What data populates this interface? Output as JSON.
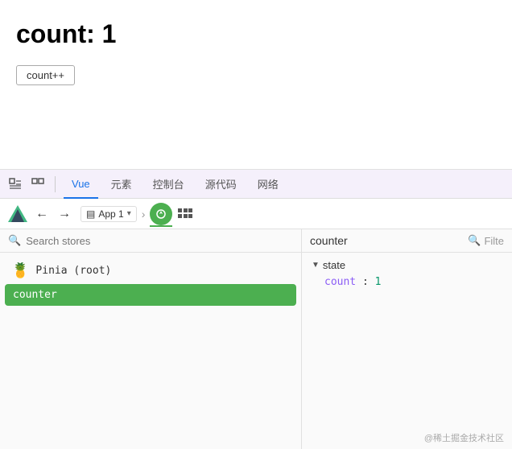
{
  "app": {
    "count_label": "count: 1",
    "button_label": "count++"
  },
  "devtools": {
    "toolbar": {
      "tabs": [
        "Vue",
        "元素",
        "控制台",
        "源代码",
        "网络"
      ],
      "active_tab": "Vue"
    },
    "vue_bar": {
      "app_name": "App 1",
      "breadcrumb_arrow": "›"
    },
    "left": {
      "search_placeholder": "Search stores",
      "stores": [
        {
          "emoji": "🍍",
          "name": "Pinia (root)"
        },
        {
          "name": "counter",
          "selected": true
        }
      ]
    },
    "right": {
      "store_name": "counter",
      "filter_label": "Filte",
      "state_label": "state",
      "count_key": "count",
      "count_value": "1"
    }
  },
  "watermark": "@稀土掘金技术社区"
}
